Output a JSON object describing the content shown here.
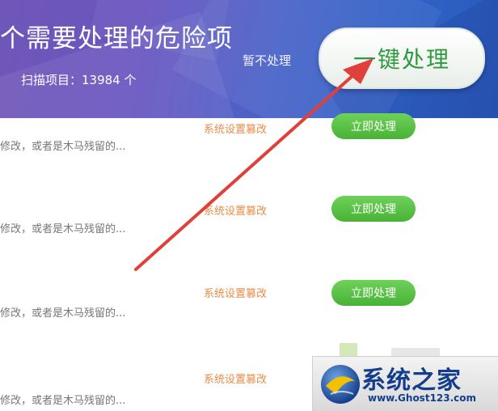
{
  "header": {
    "title": "个需要处理的危险项",
    "scan_count": "扫描项目：13984 个",
    "skip_label": "暂不处理",
    "fix_all_label": "一键处理"
  },
  "rows": [
    {
      "desc": "修改，或者是木马残留的...",
      "category": "系统设置篡改",
      "button": "立即处理"
    },
    {
      "desc": "修改，或者是木马残留的...",
      "category": "系统设置篡改",
      "button": "立即处理"
    },
    {
      "desc": "修改，或者是木马残留的...",
      "category": "系统设置篡改",
      "button": "立即处理"
    },
    {
      "desc": "修改，或者是木马残留的...",
      "category": "系统设置篡改",
      "button": ""
    }
  ],
  "watermark": {
    "name": "系统之家",
    "url": "www.Ghost123.com"
  },
  "colors": {
    "header_start": "#6f57b8",
    "header_end": "#2a58b8",
    "accent_green": "#48b236",
    "category_orange": "#e88b48",
    "arrow_red": "#e0403a"
  },
  "icons": {
    "annotation": "red-arrow-icon",
    "watermark_logo": "globe-logo-icon"
  }
}
